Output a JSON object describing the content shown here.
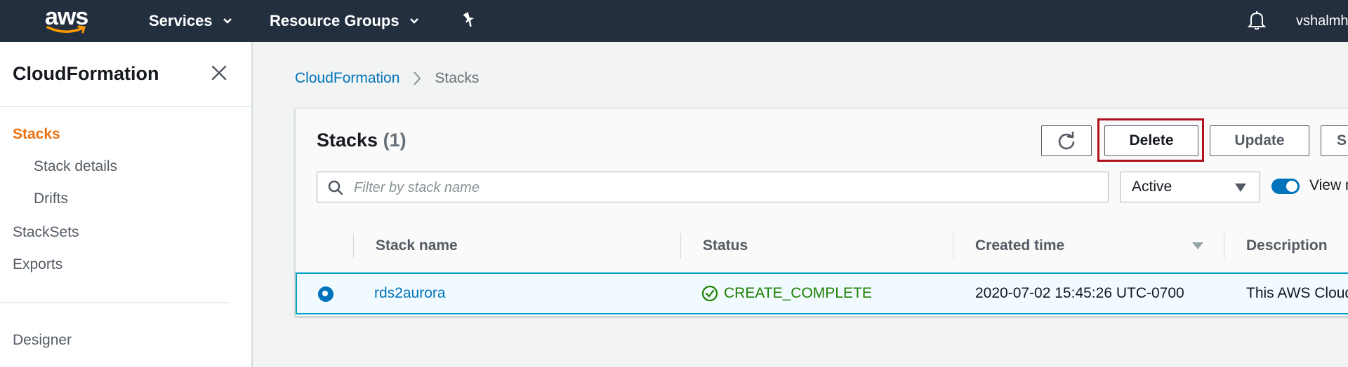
{
  "topnav": {
    "logo": "aws",
    "services_label": "Services",
    "resource_groups_label": "Resource Groups",
    "username": "vshalmh"
  },
  "sidebar": {
    "title": "CloudFormation",
    "items": [
      {
        "label": "Stacks"
      },
      {
        "label": "Stack details"
      },
      {
        "label": "Drifts"
      },
      {
        "label": "StackSets"
      },
      {
        "label": "Exports"
      },
      {
        "label": "Designer"
      }
    ]
  },
  "breadcrumb": {
    "root": "CloudFormation",
    "current": "Stacks"
  },
  "panel": {
    "title": "Stacks",
    "count": "(1)",
    "delete_label": "Delete",
    "update_label": "Update",
    "more_label": "S",
    "search_placeholder": "Filter by stack name",
    "filter_value": "Active",
    "toggle_label": "View n"
  },
  "table": {
    "columns": [
      "Stack name",
      "Status",
      "Created time",
      "Description"
    ],
    "rows": [
      {
        "name": "rds2aurora",
        "status": "CREATE_COMPLETE",
        "created": "2020-07-02 15:45:26 UTC-0700",
        "description": "This AWS Cloud"
      }
    ]
  },
  "colors": {
    "nav_bg": "#232f3e",
    "accent_orange": "#ec7211",
    "link_blue": "#0073bb",
    "success_green": "#1d8102",
    "highlight_red": "#b0101b"
  }
}
